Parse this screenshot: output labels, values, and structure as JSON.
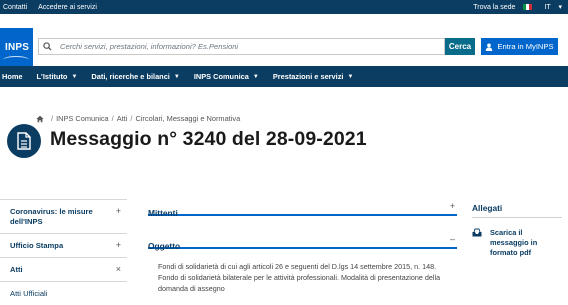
{
  "topbar": {
    "links": [
      "Contatti",
      "Accedere ai servizi"
    ],
    "find_office": "Trova la sede",
    "language": "IT"
  },
  "header": {
    "logo_text": "INPS",
    "search_placeholder": "Cerchi servizi, prestazioni, informazioni? Es.Pensioni",
    "search_button": "Cerca",
    "login_button": "Entra in MyINPS"
  },
  "nav": {
    "items": [
      {
        "label": "Home"
      },
      {
        "label": "L'Istituto"
      },
      {
        "label": "Dati, ricerche e bilanci"
      },
      {
        "label": "INPS Comunica"
      },
      {
        "label": "Prestazioni e servizi"
      }
    ]
  },
  "breadcrumb": [
    "INPS Comunica",
    "Atti",
    "Circolari, Messaggi e Normativa"
  ],
  "page": {
    "title": "Messaggio n° 3240 del 28-09-2021"
  },
  "sidebar": {
    "items": [
      {
        "label": "Coronavirus: le misure dell'INPS",
        "symbol": "+"
      },
      {
        "label": "Ufficio Stampa",
        "symbol": "+"
      },
      {
        "label": "Atti",
        "symbol": "×"
      },
      {
        "label": "Atti Ufficiali",
        "symbol": ""
      }
    ]
  },
  "main": {
    "mittenti": {
      "heading": "Mittenti",
      "symbol": "+"
    },
    "oggetto": {
      "heading": "Oggetto",
      "symbol": "–"
    },
    "oggetto_text": "Fondi di solidarietà di cui agli articoli 26 e seguenti del D.lgs 14 settembre 2015, n. 148. Fondo di solidarietà bilaterale per le attività professionali. Modalità di presentazione della domanda di assegno"
  },
  "allegati": {
    "heading": "Allegati",
    "download_label": "Scarica il messaggio in formato pdf"
  },
  "colors": {
    "navy": "#0b3d63",
    "blue": "#0066cc",
    "search_button": "#0a6c8b"
  }
}
